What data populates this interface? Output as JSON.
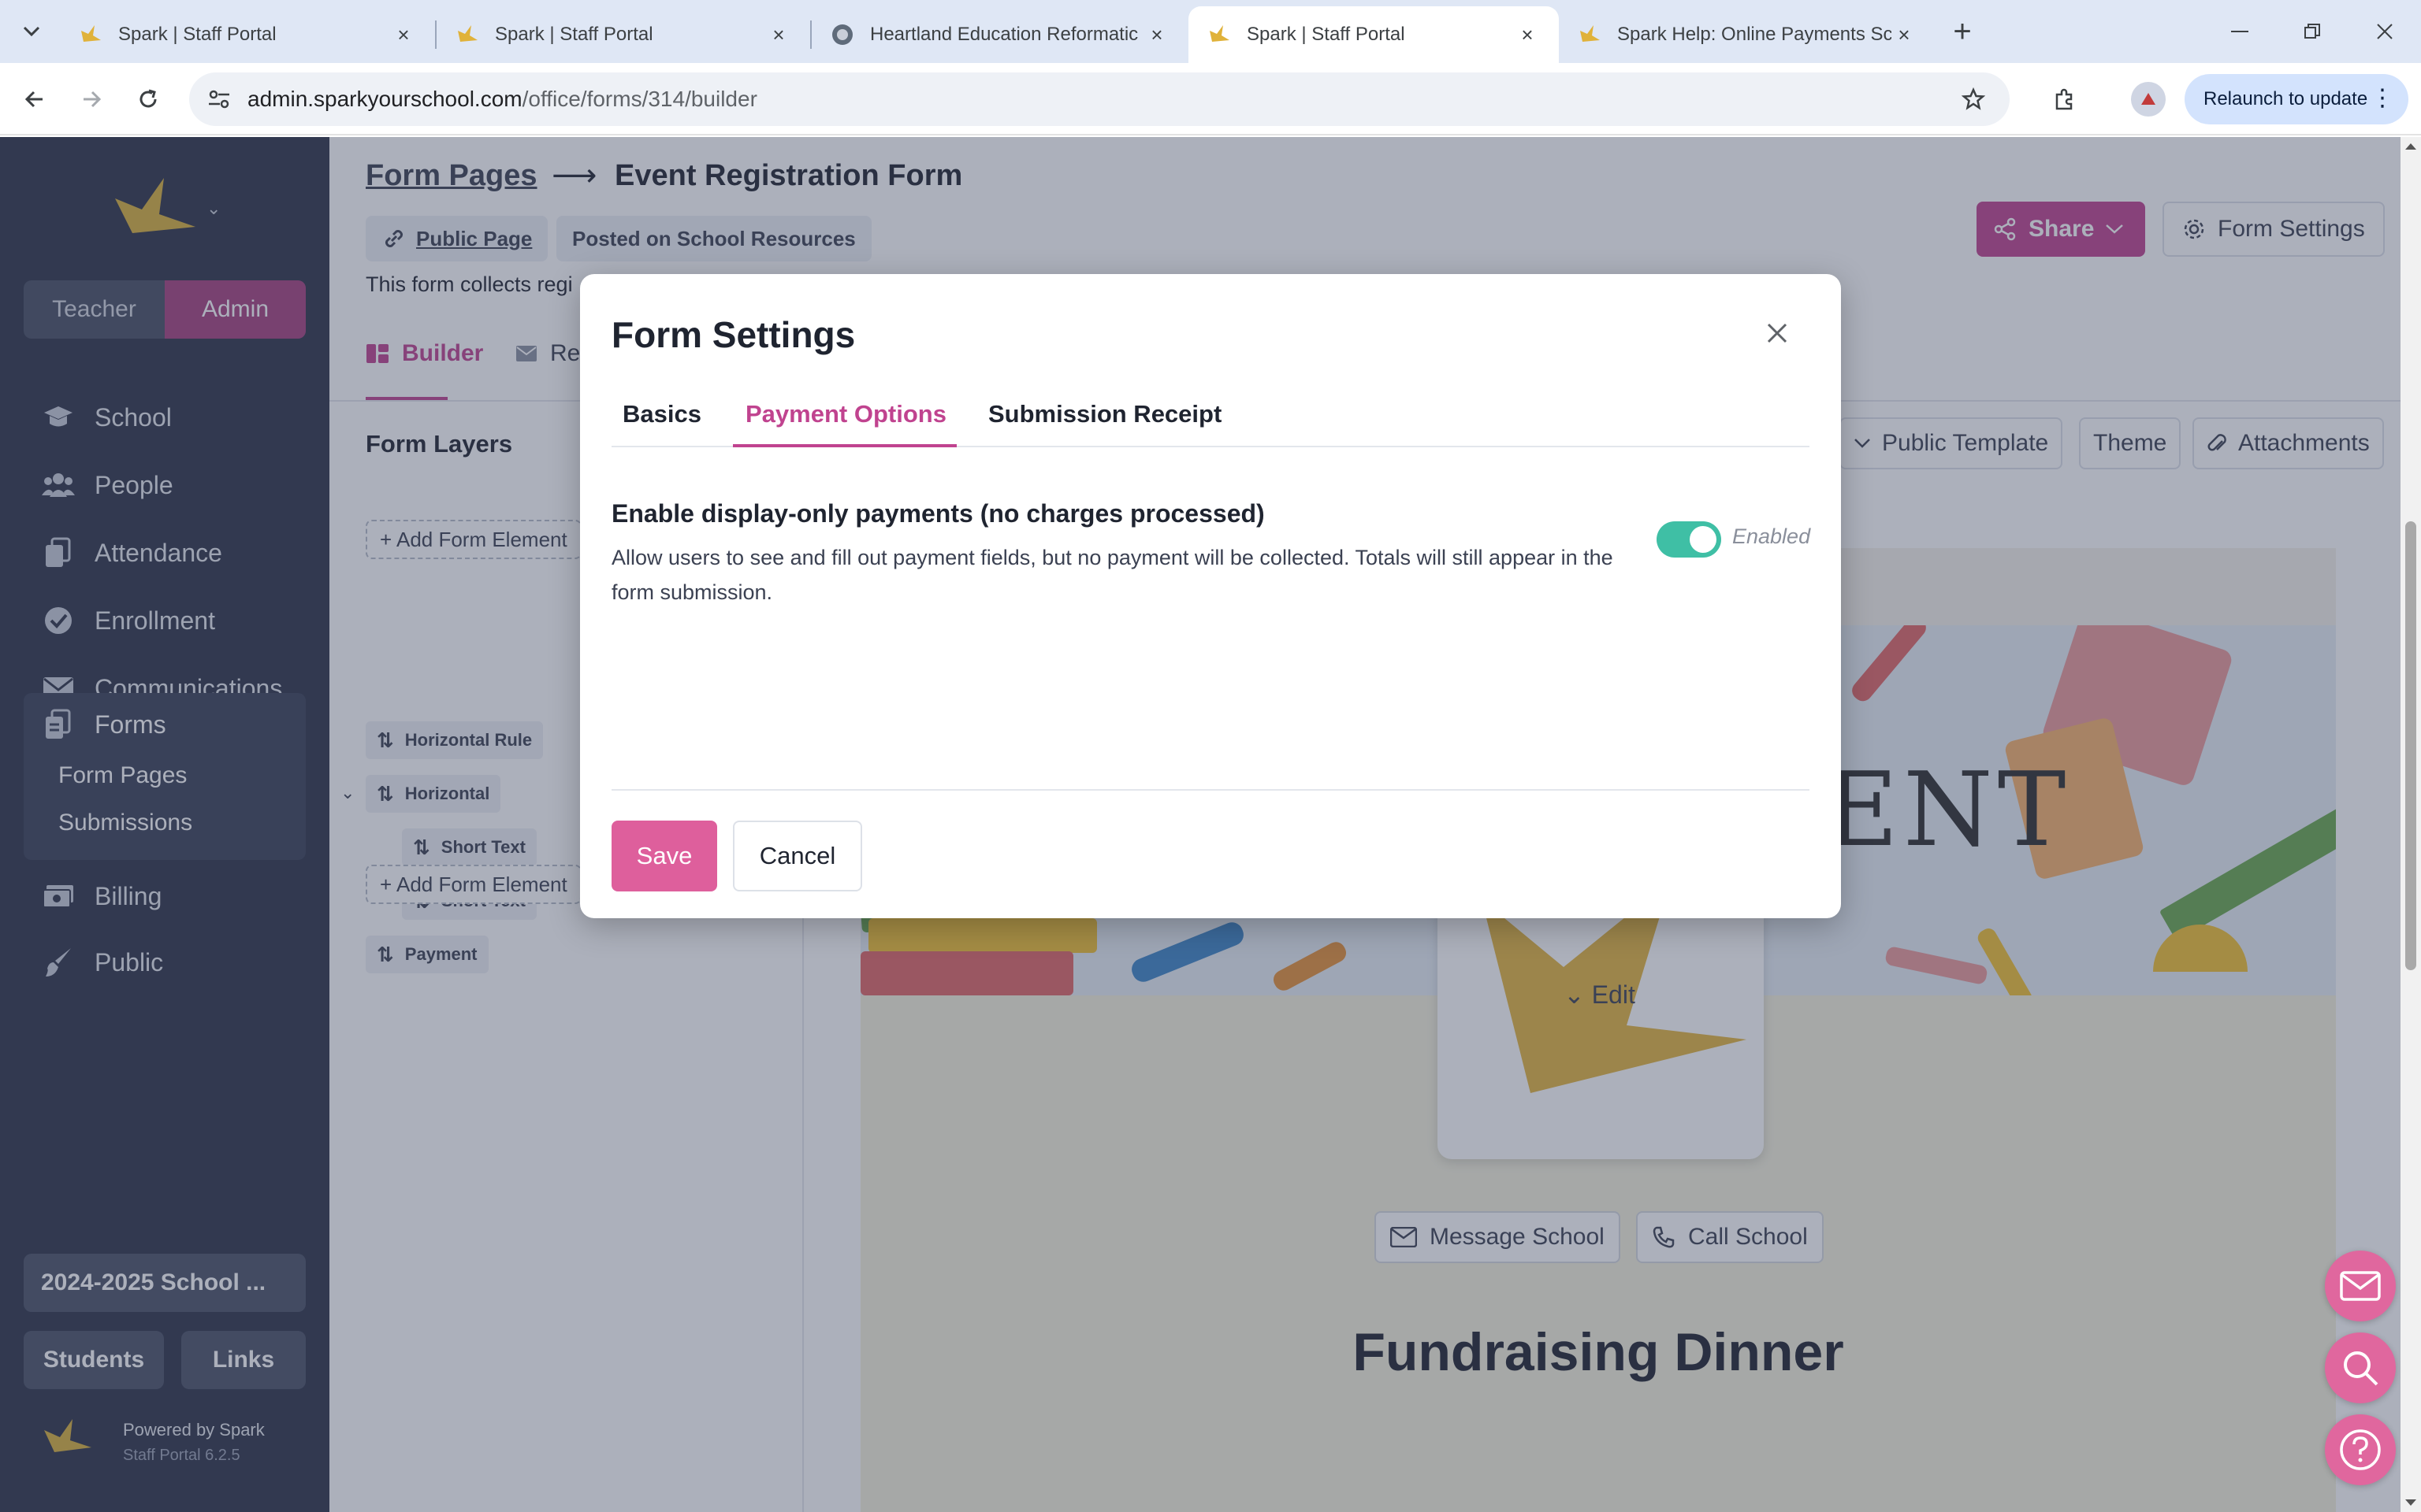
{
  "browser": {
    "tabs": [
      {
        "title": "Spark | Staff Portal",
        "active": false
      },
      {
        "title": "Spark | Staff Portal",
        "active": false
      },
      {
        "title": "Heartland Education Reformatic",
        "active": false
      },
      {
        "title": "Spark | Staff Portal",
        "active": true
      },
      {
        "title": "Spark Help: Online Payments Sc",
        "active": false
      }
    ],
    "url_host": "admin.sparkyourschool.com",
    "url_path": "/office/forms/314/builder",
    "relaunch_label": "Relaunch to update"
  },
  "sidebar": {
    "roles": {
      "teacher": "Teacher",
      "admin": "Admin",
      "active": "Admin"
    },
    "nav": {
      "school": "School",
      "people": "People",
      "attendance": "Attendance",
      "enrollment": "Enrollment",
      "communications": "Communications",
      "forms": "Forms",
      "billing": "Billing",
      "public": "Public"
    },
    "forms_sub": {
      "form_pages": "Form Pages",
      "submissions": "Submissions"
    },
    "school_year": "2024-2025 School ...",
    "students": "Students",
    "links": "Links",
    "powered_by": "Powered by Spark",
    "version": "Staff Portal 6.2.5",
    "colors": {
      "bg": "#2d3348",
      "accent": "#a6407f"
    }
  },
  "page": {
    "breadcrumb_link": "Form Pages",
    "title": "Event Registration Form",
    "public_page": "Public Page",
    "posted_on": "Posted on School Resources",
    "description": "This form collects regi",
    "share": "Share",
    "form_settings": "Form Settings",
    "tabs": {
      "builder": "Builder",
      "second": "Re"
    },
    "layers_title": "Form Layers",
    "add_form_element": "+ Add Form Element",
    "layers": {
      "horizontal_rule": "Horizontal Rule",
      "horizontal": "Horizontal",
      "short_text_1": "Short Text",
      "short_text_2": "Short Text",
      "payment": "Payment"
    },
    "toolbar": {
      "public_template": "Public Template",
      "theme": "Theme",
      "attachments": "Attachments"
    },
    "preview": {
      "banner_text": "SCHOOL EVENT",
      "edit": "Edit",
      "message_school": "Message School",
      "call_school": "Call School",
      "event_title": "Fundraising Dinner"
    }
  },
  "modal": {
    "title": "Form Settings",
    "tabs": {
      "basics": "Basics",
      "payment_options": "Payment Options",
      "submission_receipt": "Submission Receipt",
      "active": "Payment Options"
    },
    "option_title": "Enable display-only payments (no charges processed)",
    "option_description": "Allow users to see and fill out payment fields, but no payment will be collected. Totals will still appear in the form submission.",
    "toggle_on": true,
    "toggle_label": "Enabled",
    "save": "Save",
    "cancel": "Cancel",
    "colors": {
      "accent": "#c0438f",
      "save": "#de5f9c",
      "toggle": "#3fbfa5"
    }
  }
}
